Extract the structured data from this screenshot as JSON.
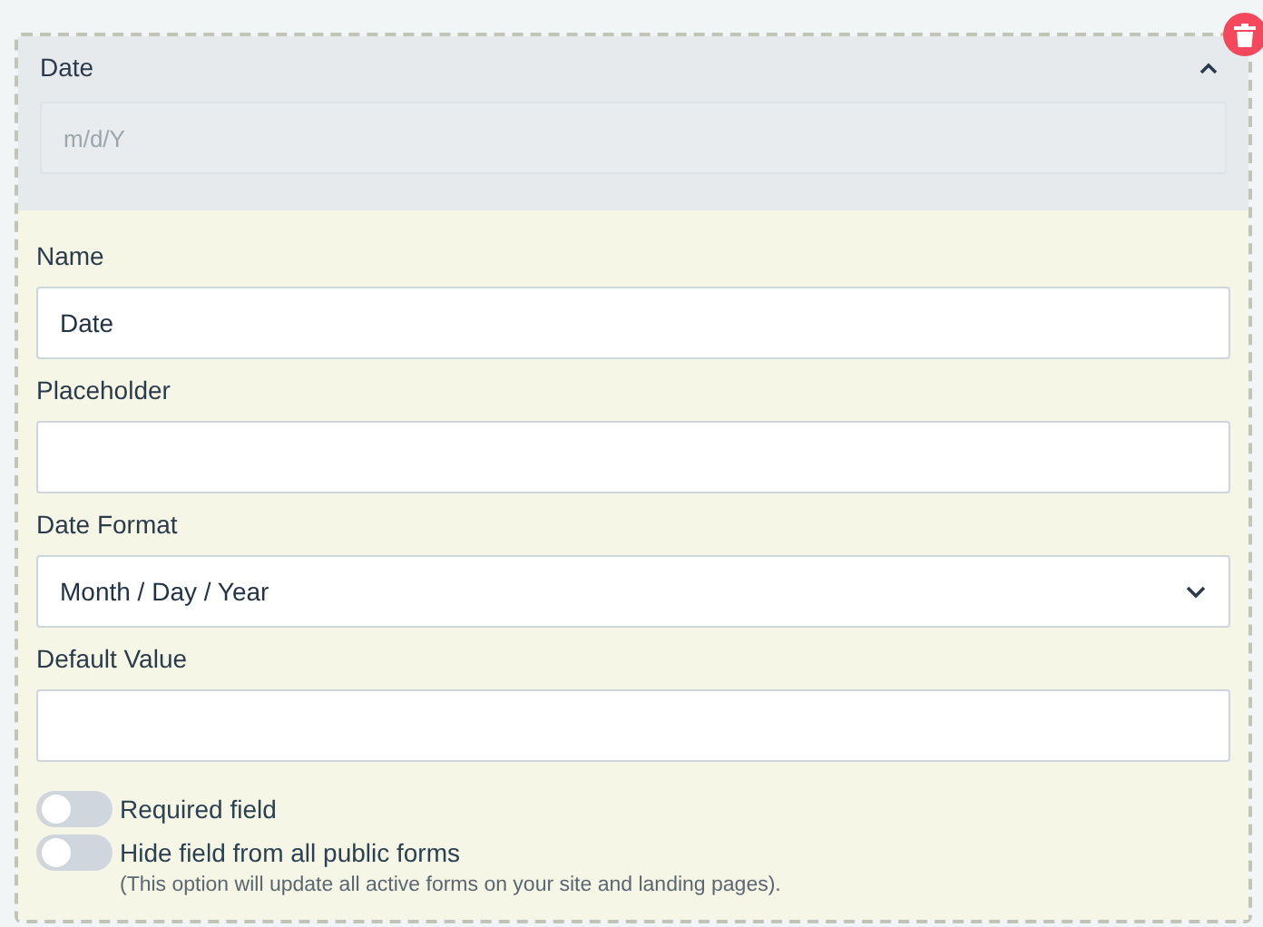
{
  "header": {
    "title": "Date",
    "expanded": true,
    "preview": {
      "placeholder": "m/d/Y"
    }
  },
  "fields": [
    {
      "kind": "text",
      "label": "Name",
      "value": "Date"
    },
    {
      "kind": "text",
      "label": "Placeholder"
    },
    {
      "kind": "select",
      "label": "Date Format",
      "value": "Month / Day / Year"
    },
    {
      "kind": "text",
      "label": "Default Value"
    }
  ],
  "toggles": [
    {
      "label": "Required field",
      "on": false
    },
    {
      "label": "Hide field from all public forms",
      "on": false,
      "note": "(This option will update all active forms on your site and landing pages)."
    }
  ]
}
